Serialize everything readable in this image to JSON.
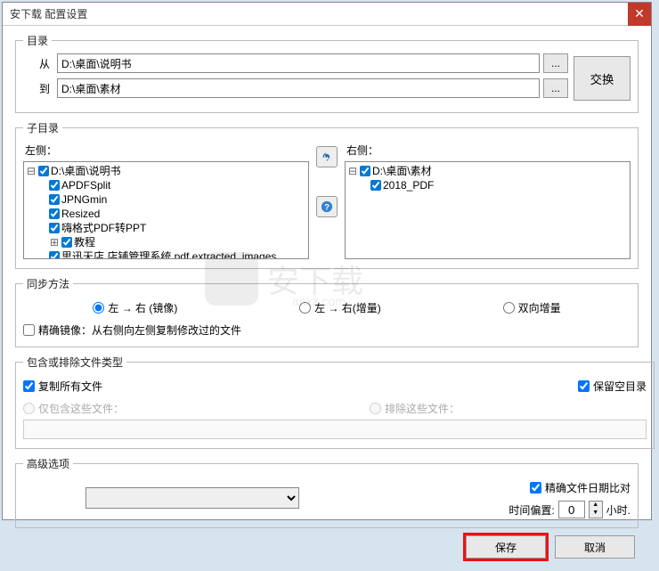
{
  "title": "安下载 配置设置",
  "directory": {
    "legend": "目录",
    "from_label": "从",
    "to_label": "到",
    "from_path": "D:\\桌面\\说明书",
    "to_path": "D:\\桌面\\素材",
    "browse_label": "...",
    "swap_label": "交换"
  },
  "subdirs": {
    "legend": "子目录",
    "left_label": "左侧：",
    "right_label": "右侧：",
    "left_tree": {
      "root": "D:\\桌面\\说明书",
      "items": [
        "APDFSplit",
        "JPNGmin",
        "Resized",
        "嗨格式PDF转PPT",
        "教程",
        "思迅天店 店铺管理系统.pdf.extracted_images"
      ]
    },
    "right_tree": {
      "root": "D:\\桌面\\素材",
      "items": [
        "2018_PDF"
      ]
    }
  },
  "sync": {
    "legend": "同步方法",
    "options": [
      "左 → 右 (镜像)",
      "左 → 右(增量)",
      "双向增量"
    ],
    "selected": 0,
    "precise_mirror_label": "精确镜像：从右侧向左侧复制修改过的文件",
    "precise_mirror_checked": false
  },
  "filetype": {
    "legend": "包含或排除文件类型",
    "copy_all_label": "复制所有文件",
    "copy_all_checked": true,
    "keep_empty_label": "保留空目录",
    "keep_empty_checked": true,
    "include_label": "仅包含这些文件：",
    "exclude_label": "排除这些文件："
  },
  "advanced": {
    "legend": "高级选项",
    "combo_value": "",
    "date_cmp_label": "精确文件日期比对",
    "date_cmp_checked": true,
    "time_offset_label": "时间偏置:",
    "time_offset_value": "0",
    "hours_label": "小时."
  },
  "buttons": {
    "save": "保存",
    "cancel": "取消"
  },
  "watermark": {
    "text": "安下载",
    "sub": "anxz.com"
  }
}
